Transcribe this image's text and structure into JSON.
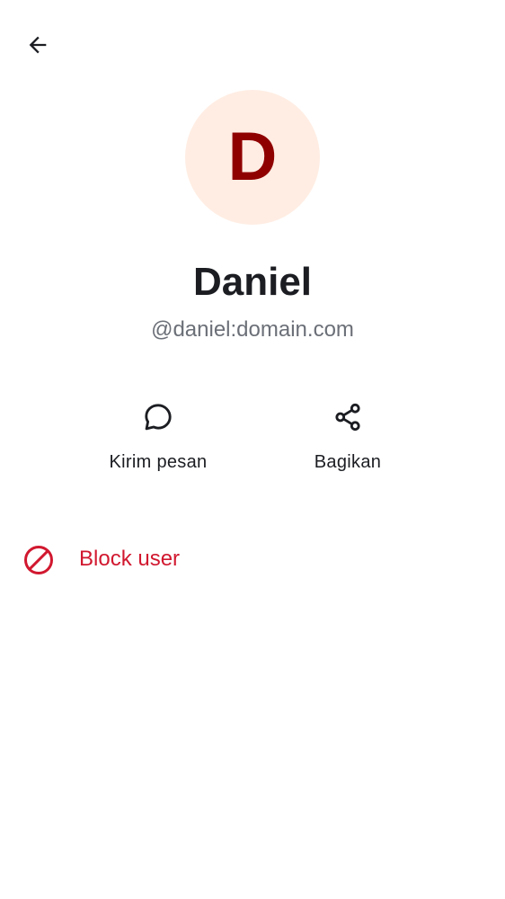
{
  "header": {
    "back_icon": "arrow-left-icon"
  },
  "profile": {
    "avatar_letter": "D",
    "avatar_bg": "#ffede3",
    "avatar_fg": "#8f0000",
    "name": "Daniel",
    "user_id": "@daniel:domain.com"
  },
  "actions": {
    "message": {
      "icon": "chat-bubble-icon",
      "label": "Kirim pesan"
    },
    "share": {
      "icon": "share-icon",
      "label": "Bagikan"
    }
  },
  "block": {
    "icon": "block-icon",
    "label": "Block user",
    "color": "#d1182f"
  }
}
